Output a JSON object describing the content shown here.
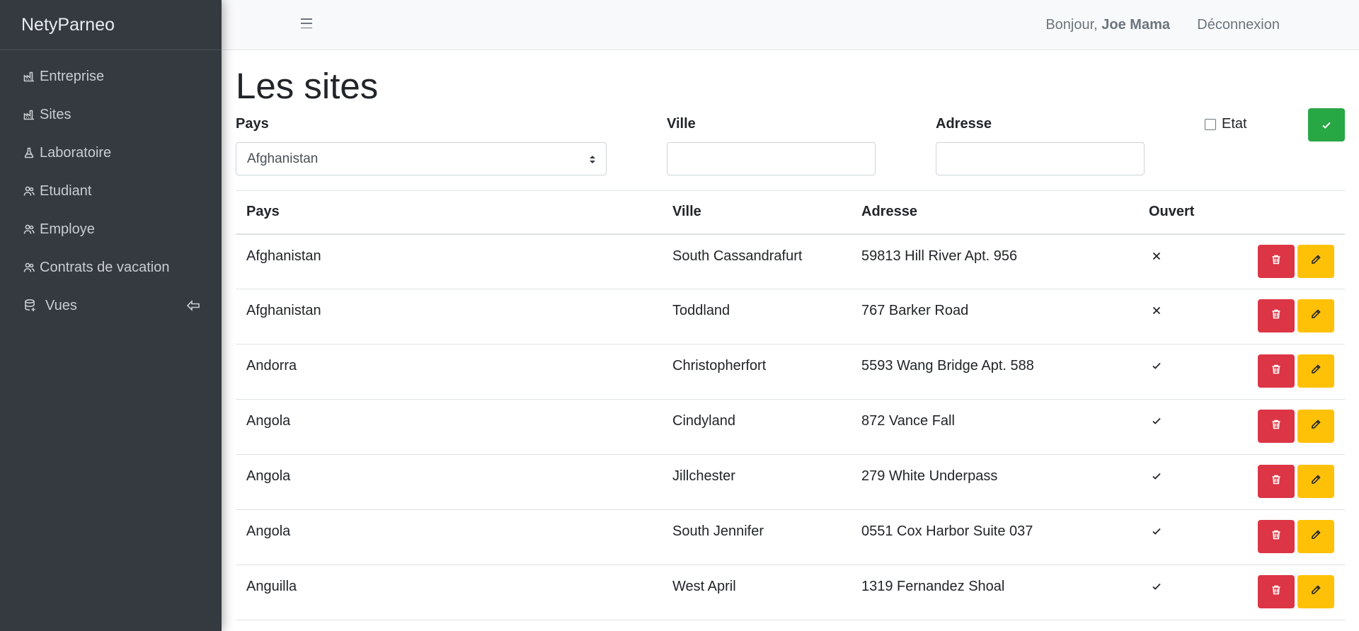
{
  "brand": "NetyParneo",
  "sidebar": {
    "items": [
      {
        "label": "Entreprise",
        "icon": "factory-icon"
      },
      {
        "label": "Sites",
        "icon": "factory-icon"
      },
      {
        "label": "Laboratoire",
        "icon": "flask-icon"
      },
      {
        "label": "Etudiant",
        "icon": "people-icon"
      },
      {
        "label": "Employe",
        "icon": "people-icon"
      },
      {
        "label": "Contrats de vacation",
        "icon": "people-icon"
      },
      {
        "label": "Vues",
        "icon": "database-icon"
      }
    ]
  },
  "header": {
    "greeting_prefix": "Bonjour, ",
    "user_name": "Joe Mama",
    "logout_label": "Déconnexion"
  },
  "page": {
    "title": "Les sites"
  },
  "filters": {
    "pays_label": "Pays",
    "pays_value": "Afghanistan",
    "ville_label": "Ville",
    "ville_value": "",
    "adresse_label": "Adresse",
    "adresse_value": "",
    "etat_label": "Etat",
    "etat_checked": false
  },
  "table": {
    "columns": [
      "Pays",
      "Ville",
      "Adresse",
      "Ouvert"
    ],
    "rows": [
      {
        "pays": "Afghanistan",
        "ville": "South Cassandrafurt",
        "adresse": "59813 Hill River Apt. 956",
        "ouvert": false
      },
      {
        "pays": "Afghanistan",
        "ville": "Toddland",
        "adresse": "767 Barker Road",
        "ouvert": false
      },
      {
        "pays": "Andorra",
        "ville": "Christopherfort",
        "adresse": "5593 Wang Bridge Apt. 588",
        "ouvert": true
      },
      {
        "pays": "Angola",
        "ville": "Cindyland",
        "adresse": "872 Vance Fall",
        "ouvert": true
      },
      {
        "pays": "Angola",
        "ville": "Jillchester",
        "adresse": "279 White Underpass",
        "ouvert": true
      },
      {
        "pays": "Angola",
        "ville": "South Jennifer",
        "adresse": "0551 Cox Harbor Suite 037",
        "ouvert": true
      },
      {
        "pays": "Anguilla",
        "ville": "West April",
        "adresse": "1319 Fernandez Shoal",
        "ouvert": true
      }
    ]
  },
  "colors": {
    "sidebar_bg": "#343a40",
    "topbar_bg": "#f8f9fa",
    "success": "#28a745",
    "danger": "#dc3545",
    "warning": "#ffc107"
  }
}
